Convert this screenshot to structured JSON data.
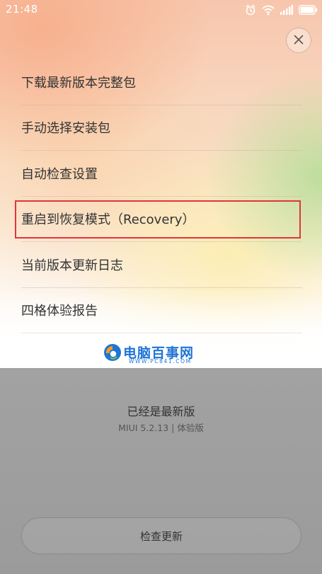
{
  "status_bar": {
    "time": "21:48",
    "icons": [
      "alarm-icon",
      "wifi-icon",
      "signal-icon",
      "battery-icon"
    ]
  },
  "menu": {
    "close_icon": "close-icon",
    "items": [
      {
        "label": "下载最新版本完整包"
      },
      {
        "label": "手动选择安装包"
      },
      {
        "label": "自动检查设置"
      },
      {
        "label": "重启到恢复模式（Recovery）"
      },
      {
        "label": "当前版本更新日志"
      },
      {
        "label": "四格体验报告"
      }
    ],
    "highlighted_index": 3,
    "highlight_color": "#e0353a"
  },
  "watermark": {
    "title": "电脑百事网",
    "url": "WWW.PC841.COM",
    "color": "#1f74d6"
  },
  "update": {
    "status": "已经是最新版",
    "version": "MIUI 5.2.13 | 体验版",
    "check_button": "检查更新"
  }
}
